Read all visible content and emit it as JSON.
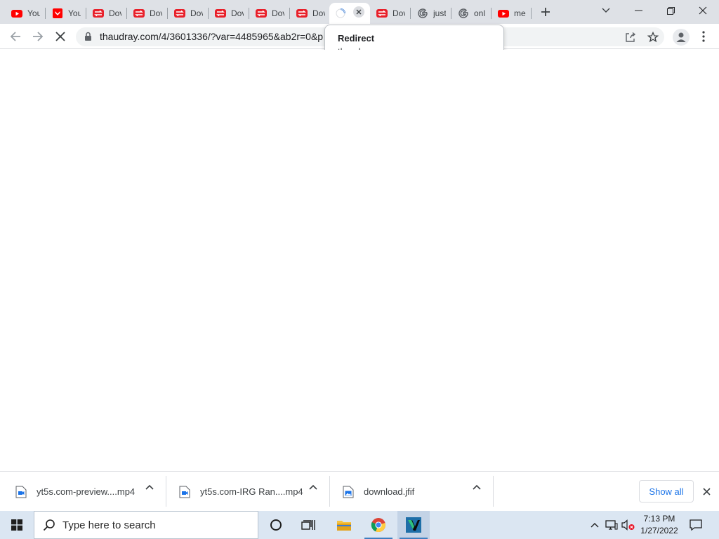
{
  "browser": {
    "tabs": [
      {
        "label": "You",
        "favicon": "youtube-icon"
      },
      {
        "label": "You",
        "favicon": "youtube-bookmark-icon"
      },
      {
        "label": "Dov",
        "favicon": "redirect-icon"
      },
      {
        "label": "Dov",
        "favicon": "redirect-icon"
      },
      {
        "label": "Dov",
        "favicon": "redirect-icon"
      },
      {
        "label": "Dov",
        "favicon": "redirect-icon"
      },
      {
        "label": "Dov",
        "favicon": "redirect-icon"
      },
      {
        "label": "Dov",
        "favicon": "redirect-icon"
      },
      {
        "label": "",
        "favicon": "loading-spinner-icon"
      },
      {
        "label": "Dov",
        "favicon": "redirect-icon"
      },
      {
        "label": "just",
        "favicon": "google-icon"
      },
      {
        "label": "onl",
        "favicon": "google-icon"
      },
      {
        "label": "me",
        "favicon": "youtube-icon"
      }
    ],
    "address": {
      "url": "thaudray.com/4/3601336/?var=4485965&ab2r=0&p"
    },
    "tooltip": {
      "title": "Redirect",
      "host": "thaudray.com"
    }
  },
  "downloads": {
    "items": [
      {
        "name": "yt5s.com-preview....mp4",
        "type": "video-file-icon"
      },
      {
        "name": "yt5s.com-IRG Ran....mp4",
        "type": "video-file-icon"
      },
      {
        "name": "download.jfif",
        "type": "image-file-icon"
      }
    ],
    "show_all_label": "Show all"
  },
  "taskbar": {
    "search_placeholder": "Type here to search",
    "time": "7:13 PM",
    "date": "1/27/2022"
  },
  "colors": {
    "youtube_red": "#ff0000",
    "accent_blue": "#1a73e8",
    "taskbar_bg": "#dbe6f2"
  }
}
